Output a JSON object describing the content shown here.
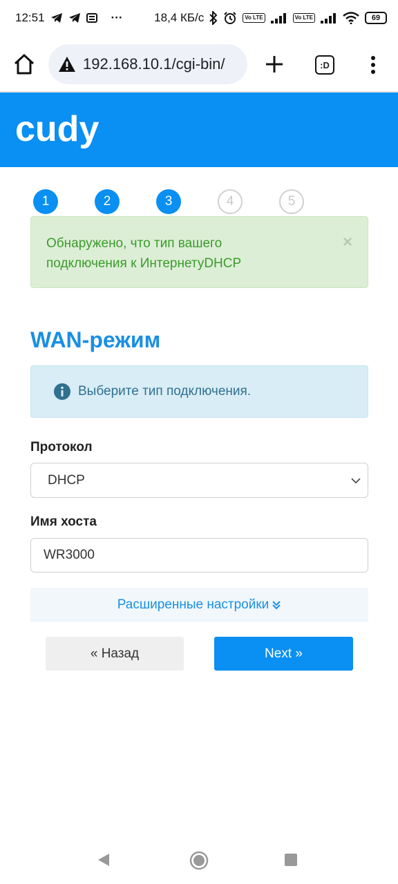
{
  "status_bar": {
    "time": "12:51",
    "more": "···",
    "speed": "18,4 КБ/с",
    "volte_label": "Vo LTE",
    "battery": "69"
  },
  "browser": {
    "url": "192.168.10.1/cgi-bin/",
    "tabs_label": ":D"
  },
  "header": {
    "logo_text": "cudy",
    "brand_color": "#0a8ff2"
  },
  "wizard": {
    "steps": [
      {
        "label": "1",
        "state": "done"
      },
      {
        "label": "2",
        "state": "done"
      },
      {
        "label": "3",
        "state": "done"
      },
      {
        "label": "4",
        "state": "todo"
      },
      {
        "label": "5",
        "state": "todo"
      }
    ]
  },
  "detected_alert": {
    "line1": "Обнаружено, что тип вашего",
    "line2": "подключения к ИнтернетуDHCP",
    "close": "×"
  },
  "wan": {
    "title": "WAN-режим",
    "info": "Выберите тип подключения.",
    "protocol_label": "Протокол",
    "protocol_value": "DHCP",
    "hostname_label": "Имя хоста",
    "hostname_value": "WR3000",
    "advanced_label": "Расширенные настройки"
  },
  "buttons": {
    "back": "« Назад",
    "next": "Next »"
  }
}
